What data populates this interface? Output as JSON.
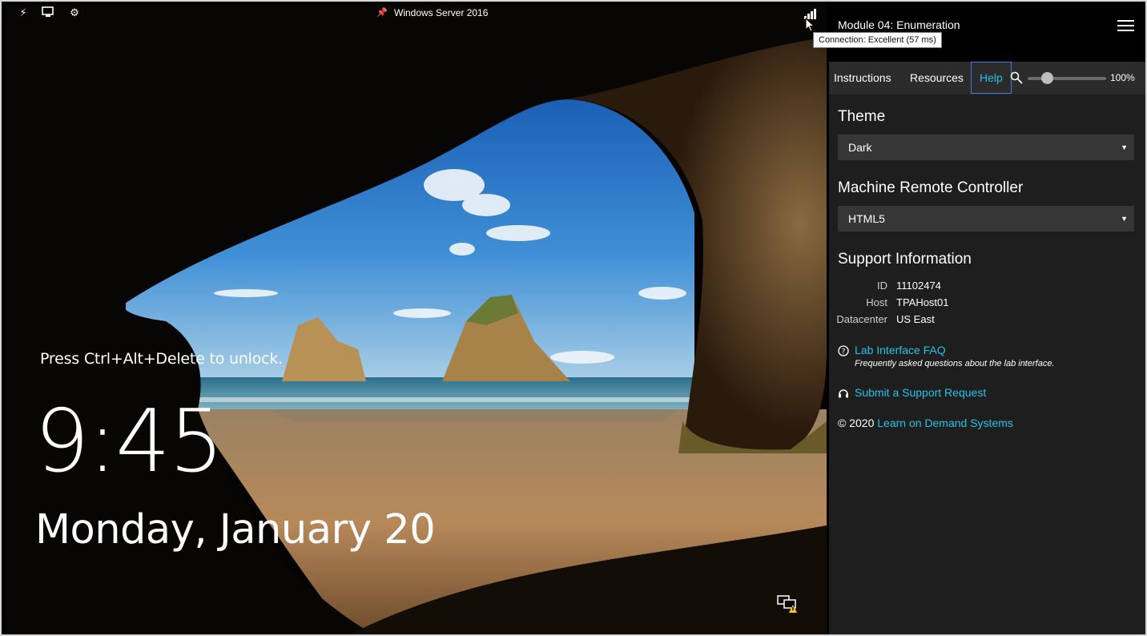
{
  "vm": {
    "title": "Windows Server 2016",
    "toolbar_icons": [
      "lightning-icon",
      "monitor-icon",
      "gear-icon"
    ],
    "lock_screen": {
      "unlock_hint": "Press Ctrl+Alt+Delete to unlock.",
      "time": "9:45",
      "date": "Monday, January 20"
    }
  },
  "connection": {
    "tooltip": "Connection: Excellent (57 ms)",
    "signal_level": 4
  },
  "panel": {
    "module_title": "Module 04: Enumeration",
    "tabs": [
      {
        "label": "Instructions"
      },
      {
        "label": "Resources"
      },
      {
        "label": "Help"
      }
    ],
    "active_tab": "Help",
    "zoom": {
      "value": "100%",
      "level_fraction": 0.2
    },
    "theme": {
      "heading": "Theme",
      "selected": "Dark"
    },
    "controller": {
      "heading": "Machine Remote Controller",
      "selected": "HTML5"
    },
    "support": {
      "heading": "Support Information",
      "rows": [
        {
          "key": "ID",
          "value": "11102474"
        },
        {
          "key": "Host",
          "value": "TPAHost01"
        },
        {
          "key": "Datacenter",
          "value": "US East"
        }
      ]
    },
    "faq": {
      "label": "Lab Interface FAQ",
      "description": "Frequently asked questions about the lab interface."
    },
    "support_request": {
      "label": "Submit a Support Request"
    },
    "copyright": {
      "prefix": "© 2020 ",
      "link": "Learn on Demand Systems"
    }
  },
  "colors": {
    "accent": "#24c2e8",
    "tab_border": "#3c7ee0",
    "panel_bg": "#1e1e1e",
    "tabs_bg": "#2b2b2b",
    "select_bg": "#363636"
  }
}
